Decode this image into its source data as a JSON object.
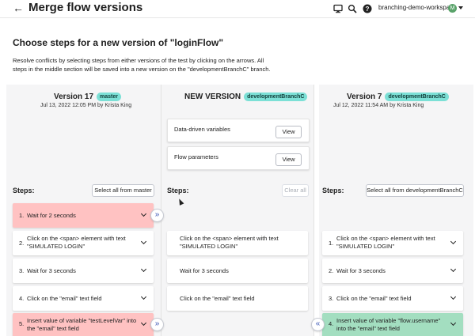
{
  "header": {
    "title": "Merge flow versions",
    "back_icon": "arrow-left-icon",
    "workspace": "branching-demo-workspace",
    "avatar_initial": "M"
  },
  "intro": {
    "title": "Choose steps for a new version of \"loginFlow\"",
    "description": "Resolve conflicts by selecting steps from either versions of the test by clicking on the arrows. All steps in the middle section will be saved into a new version on the \"developmentBranchC\" branch."
  },
  "left": {
    "version": "Version 17",
    "branch": "master",
    "meta": "Jul 13, 2022 12:05 PM by Krista King",
    "steps_label": "Steps:",
    "select_all": "Select all from master",
    "steps": [
      {
        "num": "1.",
        "text": "Wait for 2 seconds",
        "highlight": "red"
      },
      {
        "num": "2.",
        "text": "Click on the <span> element with text \"SIMULATED LOGIN\"",
        "highlight": "none"
      },
      {
        "num": "3.",
        "text": "Wait for 3 seconds",
        "highlight": "none"
      },
      {
        "num": "4.",
        "text": "Click on the \"email\" text field",
        "highlight": "none"
      },
      {
        "num": "5.",
        "text": "Insert value of variable \"testLevelVar\" into the \"email\" text field",
        "highlight": "red"
      }
    ]
  },
  "center": {
    "title": "NEW VERSION",
    "branch": "developmentBranchC",
    "data_driven_label": "Data-driven variables",
    "flow_params_label": "Flow parameters",
    "view_label": "View",
    "steps_label": "Steps:",
    "clear_all": "Clear all",
    "steps": [
      {
        "text": "Click on the <span> element with text \"SIMULATED LOGIN\""
      },
      {
        "text": "Wait for 3 seconds"
      },
      {
        "text": "Click on the \"email\" text field"
      }
    ]
  },
  "right": {
    "version": "Version 7",
    "branch": "developmentBranchC",
    "meta": "Jul 12, 2022 11:54 AM by Krista King",
    "steps_label": "Steps:",
    "select_all": "Select all from developmentBranchC",
    "steps": [
      {
        "num": "1.",
        "text": "Click on the <span> element with text \"SIMULATED LOGIN\"",
        "highlight": "none"
      },
      {
        "num": "2.",
        "text": "Wait for 3 seconds",
        "highlight": "none"
      },
      {
        "num": "3.",
        "text": "Click on the \"email\" text field",
        "highlight": "none"
      },
      {
        "num": "4.",
        "text": "Insert value of variable \"flow.username\" into the \"email\" text field",
        "highlight": "green"
      }
    ]
  },
  "arrows": {
    "right_glyph": "»",
    "left_glyph": "«"
  },
  "colors": {
    "badge": "#7ce0d6",
    "conflict_red": "#ffc2c2",
    "conflict_green": "#a3dec0",
    "arrow_blue": "#3b56b5"
  }
}
